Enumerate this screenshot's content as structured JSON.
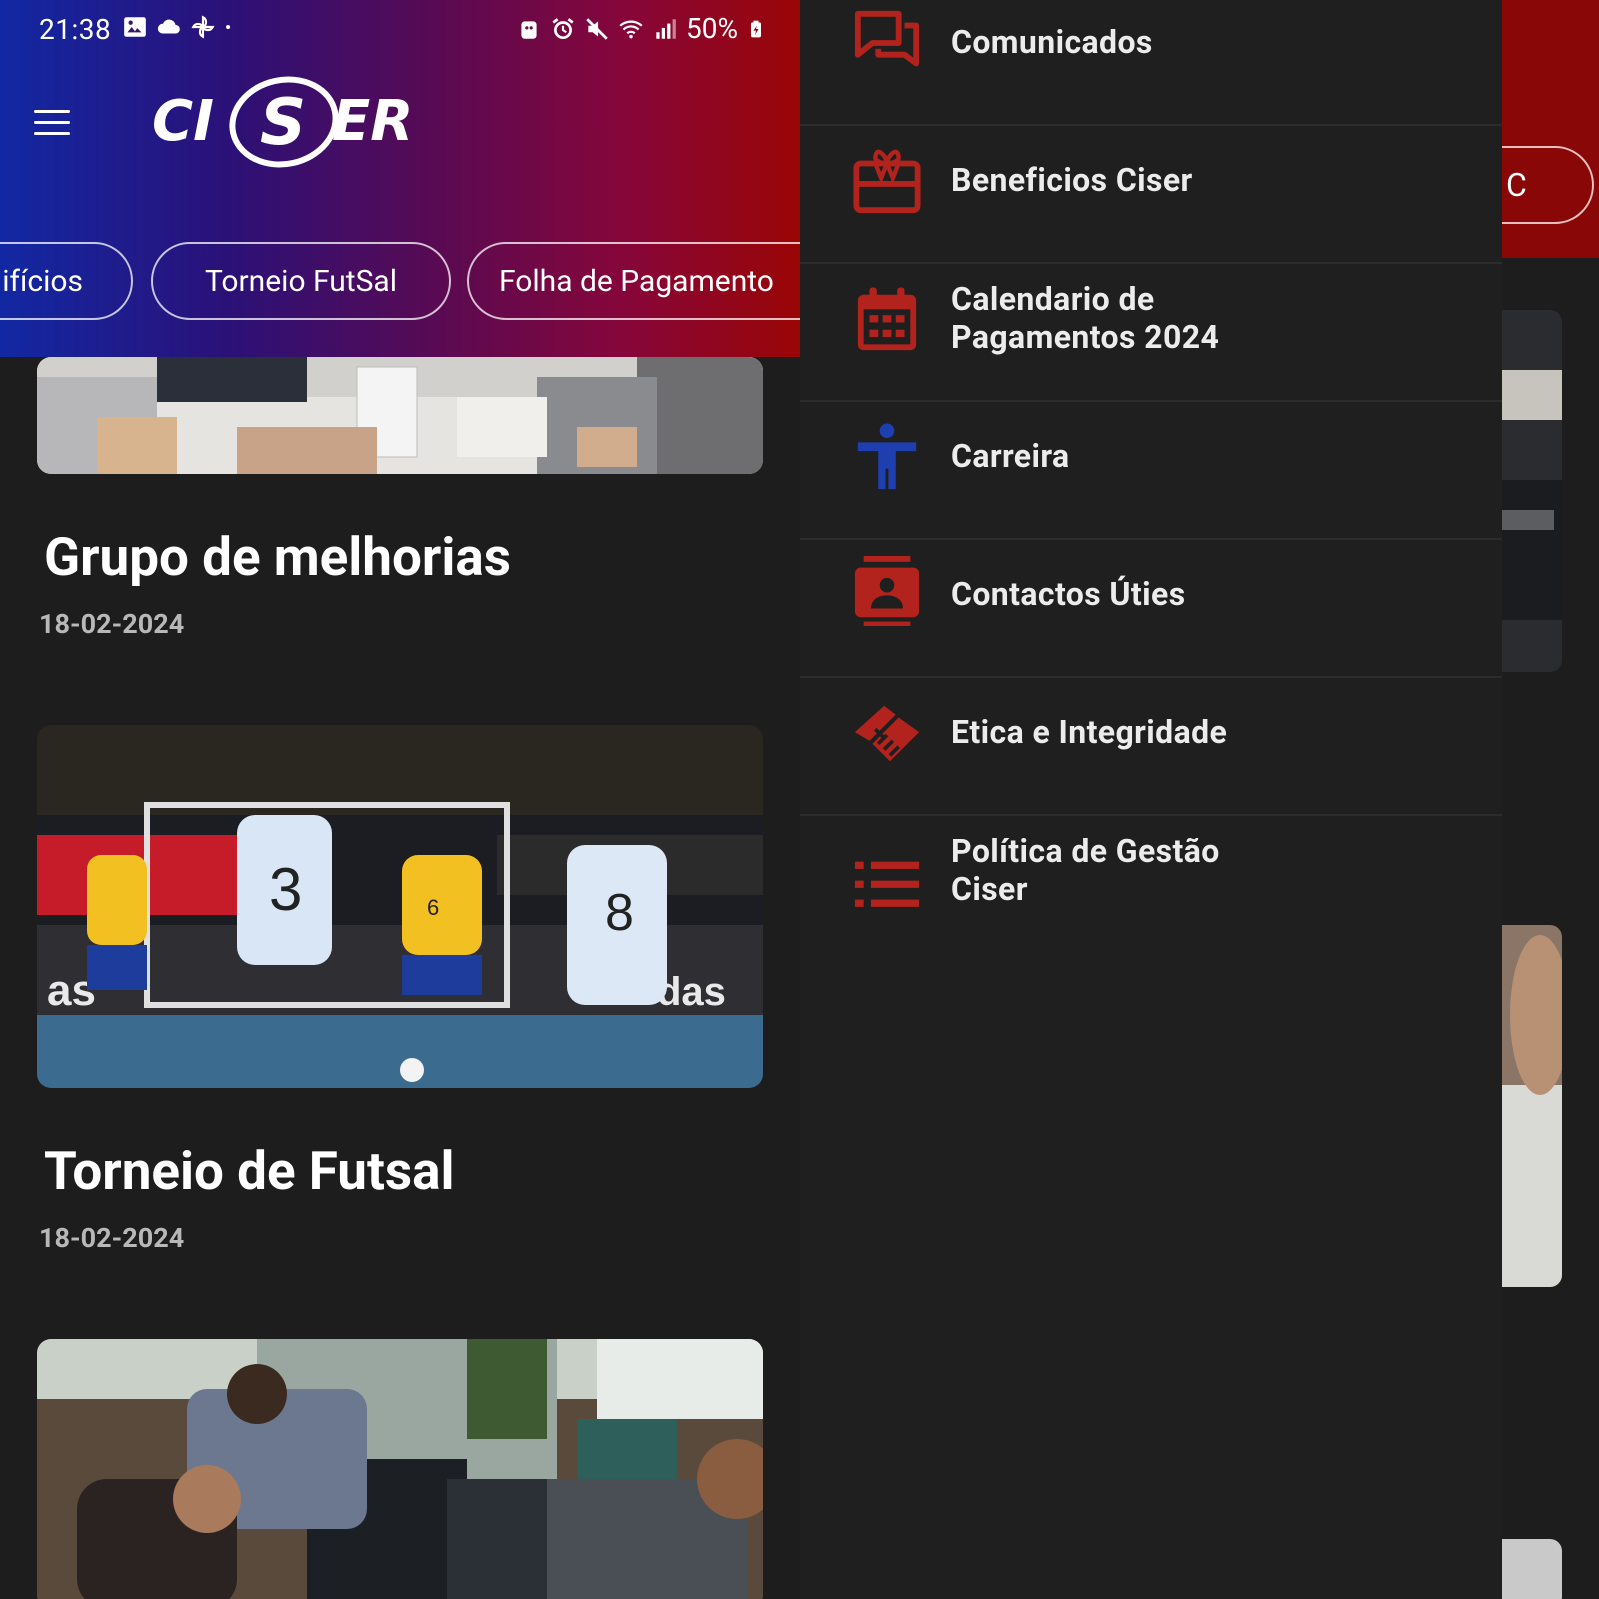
{
  "status_bar": {
    "time": "21:38",
    "battery": "50%",
    "left_icons": [
      "gallery-icon",
      "cloud-icon",
      "pinwheel-icon",
      "dot-icon"
    ],
    "right_icons": [
      "robot-icon",
      "alarm-icon",
      "mute-icon",
      "wifi-icon",
      "signal-icon",
      "battery-icon"
    ]
  },
  "header": {
    "brand": "CISER",
    "menu_icon": "hamburger-icon"
  },
  "chips": [
    {
      "label": "ifícios"
    },
    {
      "label": "Torneio FutSal"
    },
    {
      "label": "Folha de Pagamento"
    }
  ],
  "feed": {
    "posts": [
      {
        "title": "Grupo de melhorias",
        "date": "18-02-2024",
        "image": "meeting-photo"
      },
      {
        "title": "Torneio de Futsal",
        "date": "18-02-2024",
        "image": "futsal-photo"
      },
      {
        "title": "",
        "date": "",
        "image": "office-photo"
      }
    ]
  },
  "behind_drawer": {
    "chip_fragment": "C"
  },
  "drawer": {
    "items": [
      {
        "label": "Comunicados",
        "icon": "chat-bubbles-icon",
        "color": "#b3231d"
      },
      {
        "label": "Beneficios Ciser",
        "icon": "gift-card-icon",
        "color": "#b3231d"
      },
      {
        "label": "Calendario de Pagamentos 2024",
        "icon": "calendar-icon",
        "color": "#b3231d"
      },
      {
        "label": "Carreira",
        "icon": "person-icon",
        "color": "#1e3fb0"
      },
      {
        "label": "Contactos Úties",
        "icon": "contact-card-icon",
        "color": "#b3231d"
      },
      {
        "label": "Etica e Integridade",
        "icon": "handshake-icon",
        "color": "#b3231d"
      },
      {
        "label": "Política de Gestão Ciser",
        "icon": "list-icon",
        "color": "#b3231d"
      }
    ]
  },
  "colors": {
    "drawer_bg": "#1f1f1f",
    "page_bg": "#1d1d1d",
    "accent_red": "#b3231d",
    "accent_blue": "#1e3fb0",
    "header_gradient_start": "#1228a3",
    "header_gradient_end": "#9a0606"
  }
}
